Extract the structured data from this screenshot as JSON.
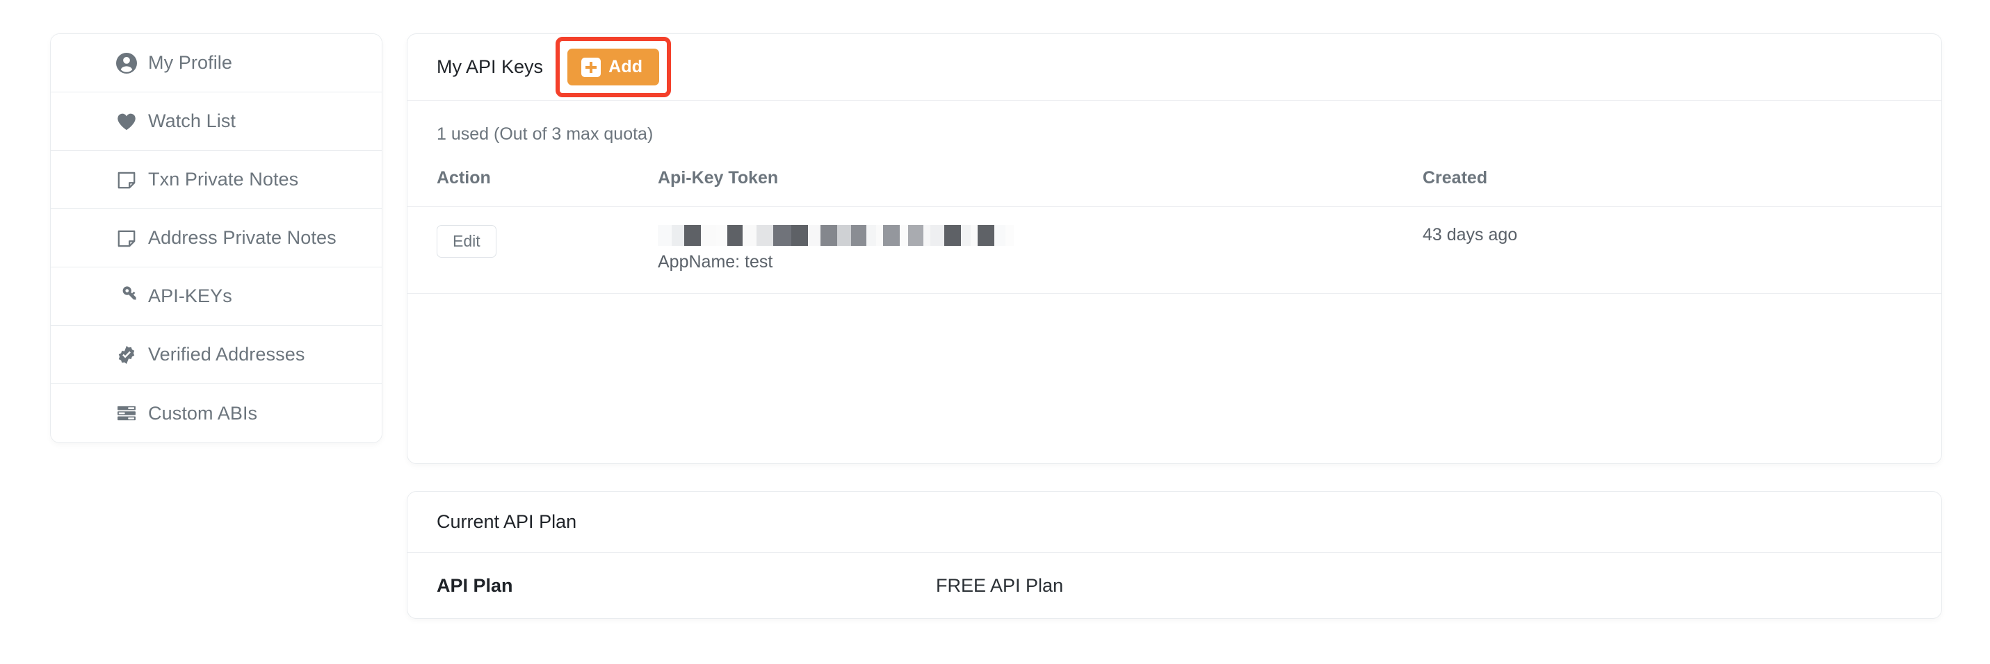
{
  "sidebar": {
    "items": [
      {
        "label": "My Profile",
        "icon": "user-circle-icon"
      },
      {
        "label": "Watch List",
        "icon": "heart-icon"
      },
      {
        "label": "Txn Private Notes",
        "icon": "note-icon"
      },
      {
        "label": "Address Private Notes",
        "icon": "note-icon"
      },
      {
        "label": "API-KEYs",
        "icon": "key-icon"
      },
      {
        "label": "Verified Addresses",
        "icon": "verified-badge-icon"
      },
      {
        "label": "Custom ABIs",
        "icon": "list-lines-icon"
      }
    ]
  },
  "api_keys_panel": {
    "title": "My API Keys",
    "add_button": {
      "label": "Add",
      "icon": "plus-square-icon"
    },
    "quota_text": "1 used (Out of 3 max quota)",
    "table": {
      "columns": [
        "Action",
        "Api-Key Token",
        "Created"
      ],
      "rows": [
        {
          "action_label": "Edit",
          "token_masked": "████████████████",
          "app_name": "AppName: test",
          "created": "43 days ago"
        }
      ]
    }
  },
  "plan_panel": {
    "title": "Current API Plan",
    "row": {
      "key": "API Plan",
      "value": "FREE API Plan"
    }
  },
  "colors": {
    "accent_orange": "#ef9c3c",
    "highlight_red": "#f4402a",
    "text_muted": "#6c757d",
    "border": "#e9ecef"
  }
}
